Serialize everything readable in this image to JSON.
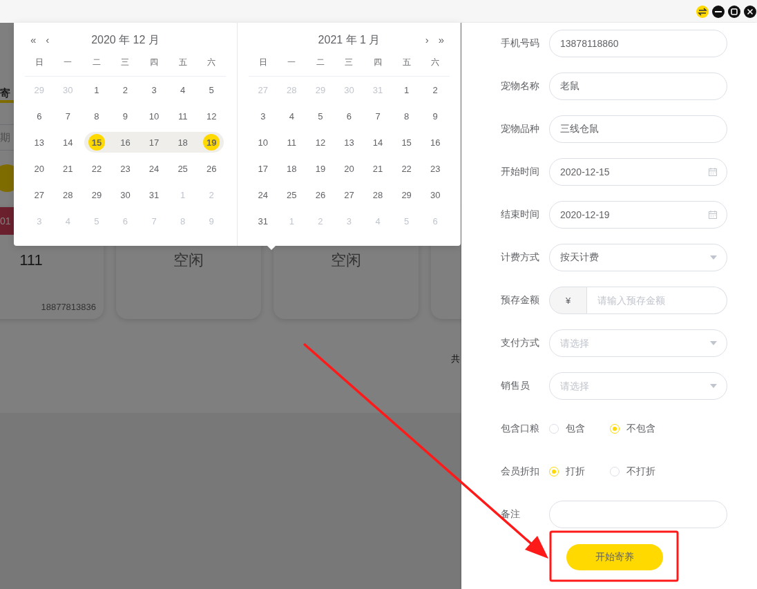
{
  "background": {
    "tab_fragment": "寄",
    "field_fragment": "期",
    "cards": [
      {
        "room": "01",
        "title": "111",
        "phone": "18877813836"
      },
      {
        "title": "空闲"
      },
      {
        "title": "空闲"
      }
    ],
    "pager_fragment": "共"
  },
  "date_picker": {
    "panels": [
      {
        "nav_left": [
          "«",
          "‹"
        ],
        "title": "2020 年 12 月",
        "weekdays": [
          "日",
          "一",
          "二",
          "三",
          "四",
          "五",
          "六"
        ],
        "weeks": [
          [
            {
              "day": "29",
              "muted": true,
              "in_range": false,
              "selected": false
            },
            {
              "day": "30",
              "muted": true,
              "in_range": false,
              "selected": false
            },
            {
              "day": "1",
              "muted": false,
              "in_range": false,
              "selected": false
            },
            {
              "day": "2",
              "muted": false,
              "in_range": false,
              "selected": false
            },
            {
              "day": "3",
              "muted": false,
              "in_range": false,
              "selected": false
            },
            {
              "day": "4",
              "muted": false,
              "in_range": false,
              "selected": false
            },
            {
              "day": "5",
              "muted": false,
              "in_range": false,
              "selected": false
            }
          ],
          [
            {
              "day": "6",
              "muted": false,
              "in_range": false,
              "selected": false
            },
            {
              "day": "7",
              "muted": false,
              "in_range": false,
              "selected": false
            },
            {
              "day": "8",
              "muted": false,
              "in_range": false,
              "selected": false
            },
            {
              "day": "9",
              "muted": false,
              "in_range": false,
              "selected": false
            },
            {
              "day": "10",
              "muted": false,
              "in_range": false,
              "selected": false
            },
            {
              "day": "11",
              "muted": false,
              "in_range": false,
              "selected": false
            },
            {
              "day": "12",
              "muted": false,
              "in_range": false,
              "selected": false
            }
          ],
          [
            {
              "day": "13",
              "muted": false,
              "in_range": false,
              "selected": false
            },
            {
              "day": "14",
              "muted": false,
              "in_range": false,
              "selected": false
            },
            {
              "day": "15",
              "muted": false,
              "in_range": true,
              "selected": true
            },
            {
              "day": "16",
              "muted": false,
              "in_range": true,
              "selected": false
            },
            {
              "day": "17",
              "muted": false,
              "in_range": true,
              "selected": false
            },
            {
              "day": "18",
              "muted": false,
              "in_range": true,
              "selected": false
            },
            {
              "day": "19",
              "muted": false,
              "in_range": true,
              "selected": true
            }
          ],
          [
            {
              "day": "20",
              "muted": false,
              "in_range": false,
              "selected": false
            },
            {
              "day": "21",
              "muted": false,
              "in_range": false,
              "selected": false
            },
            {
              "day": "22",
              "muted": false,
              "in_range": false,
              "selected": false
            },
            {
              "day": "23",
              "muted": false,
              "in_range": false,
              "selected": false
            },
            {
              "day": "24",
              "muted": false,
              "in_range": false,
              "selected": false
            },
            {
              "day": "25",
              "muted": false,
              "in_range": false,
              "selected": false
            },
            {
              "day": "26",
              "muted": false,
              "in_range": false,
              "selected": false
            }
          ],
          [
            {
              "day": "27",
              "muted": false,
              "in_range": false,
              "selected": false
            },
            {
              "day": "28",
              "muted": false,
              "in_range": false,
              "selected": false
            },
            {
              "day": "29",
              "muted": false,
              "in_range": false,
              "selected": false
            },
            {
              "day": "30",
              "muted": false,
              "in_range": false,
              "selected": false
            },
            {
              "day": "31",
              "muted": false,
              "in_range": false,
              "selected": false
            },
            {
              "day": "1",
              "muted": true,
              "in_range": false,
              "selected": false
            },
            {
              "day": "2",
              "muted": true,
              "in_range": false,
              "selected": false
            }
          ],
          [
            {
              "day": "3",
              "muted": true,
              "in_range": false,
              "selected": false
            },
            {
              "day": "4",
              "muted": true,
              "in_range": false,
              "selected": false
            },
            {
              "day": "5",
              "muted": true,
              "in_range": false,
              "selected": false
            },
            {
              "day": "6",
              "muted": true,
              "in_range": false,
              "selected": false
            },
            {
              "day": "7",
              "muted": true,
              "in_range": false,
              "selected": false
            },
            {
              "day": "8",
              "muted": true,
              "in_range": false,
              "selected": false
            },
            {
              "day": "9",
              "muted": true,
              "in_range": false,
              "selected": false
            }
          ]
        ]
      },
      {
        "nav_right": [
          "›",
          "»"
        ],
        "title": "2021 年 1 月",
        "weekdays": [
          "日",
          "一",
          "二",
          "三",
          "四",
          "五",
          "六"
        ],
        "weeks": [
          [
            {
              "day": "27",
              "muted": true,
              "in_range": false,
              "selected": false
            },
            {
              "day": "28",
              "muted": true,
              "in_range": false,
              "selected": false
            },
            {
              "day": "29",
              "muted": true,
              "in_range": false,
              "selected": false
            },
            {
              "day": "30",
              "muted": true,
              "in_range": false,
              "selected": false
            },
            {
              "day": "31",
              "muted": true,
              "in_range": false,
              "selected": false
            },
            {
              "day": "1",
              "muted": false,
              "in_range": false,
              "selected": false
            },
            {
              "day": "2",
              "muted": false,
              "in_range": false,
              "selected": false
            }
          ],
          [
            {
              "day": "3",
              "muted": false,
              "in_range": false,
              "selected": false
            },
            {
              "day": "4",
              "muted": false,
              "in_range": false,
              "selected": false
            },
            {
              "day": "5",
              "muted": false,
              "in_range": false,
              "selected": false
            },
            {
              "day": "6",
              "muted": false,
              "in_range": false,
              "selected": false
            },
            {
              "day": "7",
              "muted": false,
              "in_range": false,
              "selected": false
            },
            {
              "day": "8",
              "muted": false,
              "in_range": false,
              "selected": false
            },
            {
              "day": "9",
              "muted": false,
              "in_range": false,
              "selected": false
            }
          ],
          [
            {
              "day": "10",
              "muted": false,
              "in_range": false,
              "selected": false
            },
            {
              "day": "11",
              "muted": false,
              "in_range": false,
              "selected": false
            },
            {
              "day": "12",
              "muted": false,
              "in_range": false,
              "selected": false
            },
            {
              "day": "13",
              "muted": false,
              "in_range": false,
              "selected": false
            },
            {
              "day": "14",
              "muted": false,
              "in_range": false,
              "selected": false
            },
            {
              "day": "15",
              "muted": false,
              "in_range": false,
              "selected": false
            },
            {
              "day": "16",
              "muted": false,
              "in_range": false,
              "selected": false
            }
          ],
          [
            {
              "day": "17",
              "muted": false,
              "in_range": false,
              "selected": false
            },
            {
              "day": "18",
              "muted": false,
              "in_range": false,
              "selected": false
            },
            {
              "day": "19",
              "muted": false,
              "in_range": false,
              "selected": false
            },
            {
              "day": "20",
              "muted": false,
              "in_range": false,
              "selected": false
            },
            {
              "day": "21",
              "muted": false,
              "in_range": false,
              "selected": false
            },
            {
              "day": "22",
              "muted": false,
              "in_range": false,
              "selected": false
            },
            {
              "day": "23",
              "muted": false,
              "in_range": false,
              "selected": false
            }
          ],
          [
            {
              "day": "24",
              "muted": false,
              "in_range": false,
              "selected": false
            },
            {
              "day": "25",
              "muted": false,
              "in_range": false,
              "selected": false
            },
            {
              "day": "26",
              "muted": false,
              "in_range": false,
              "selected": false
            },
            {
              "day": "27",
              "muted": false,
              "in_range": false,
              "selected": false
            },
            {
              "day": "28",
              "muted": false,
              "in_range": false,
              "selected": false
            },
            {
              "day": "29",
              "muted": false,
              "in_range": false,
              "selected": false
            },
            {
              "day": "30",
              "muted": false,
              "in_range": false,
              "selected": false
            }
          ],
          [
            {
              "day": "31",
              "muted": false,
              "in_range": false,
              "selected": false
            },
            {
              "day": "1",
              "muted": true,
              "in_range": false,
              "selected": false
            },
            {
              "day": "2",
              "muted": true,
              "in_range": false,
              "selected": false
            },
            {
              "day": "3",
              "muted": true,
              "in_range": false,
              "selected": false
            },
            {
              "day": "4",
              "muted": true,
              "in_range": false,
              "selected": false
            },
            {
              "day": "5",
              "muted": true,
              "in_range": false,
              "selected": false
            },
            {
              "day": "6",
              "muted": true,
              "in_range": false,
              "selected": false
            }
          ]
        ]
      }
    ]
  },
  "form": {
    "fields": [
      {
        "kind": "text",
        "label": "手机号码",
        "value": "13878118860"
      },
      {
        "kind": "text",
        "label": "宠物名称",
        "value": "老鼠"
      },
      {
        "kind": "text",
        "label": "宠物品种",
        "value": "三线仓鼠"
      },
      {
        "kind": "date",
        "label": "开始时间",
        "value": "2020-12-15"
      },
      {
        "kind": "date",
        "label": "结束时间",
        "value": "2020-12-19"
      },
      {
        "kind": "select",
        "label": "计费方式",
        "value": "按天计费"
      },
      {
        "kind": "currency",
        "label": "预存金额",
        "prefix": "¥",
        "placeholder": "请输入预存金额"
      },
      {
        "kind": "select",
        "label": "支付方式",
        "placeholder": "请选择"
      },
      {
        "kind": "select",
        "label": "销售员",
        "placeholder": "请选择"
      },
      {
        "kind": "radio",
        "label": "包含口粮",
        "options": [
          {
            "label": "包含",
            "selected": false
          },
          {
            "label": "不包含",
            "selected": true
          }
        ]
      },
      {
        "kind": "radio",
        "label": "会员折扣",
        "options": [
          {
            "label": "打折",
            "selected": true
          },
          {
            "label": "不打折",
            "selected": false
          }
        ]
      },
      {
        "kind": "text",
        "label": "备注"
      }
    ],
    "submit": "开始寄养"
  }
}
